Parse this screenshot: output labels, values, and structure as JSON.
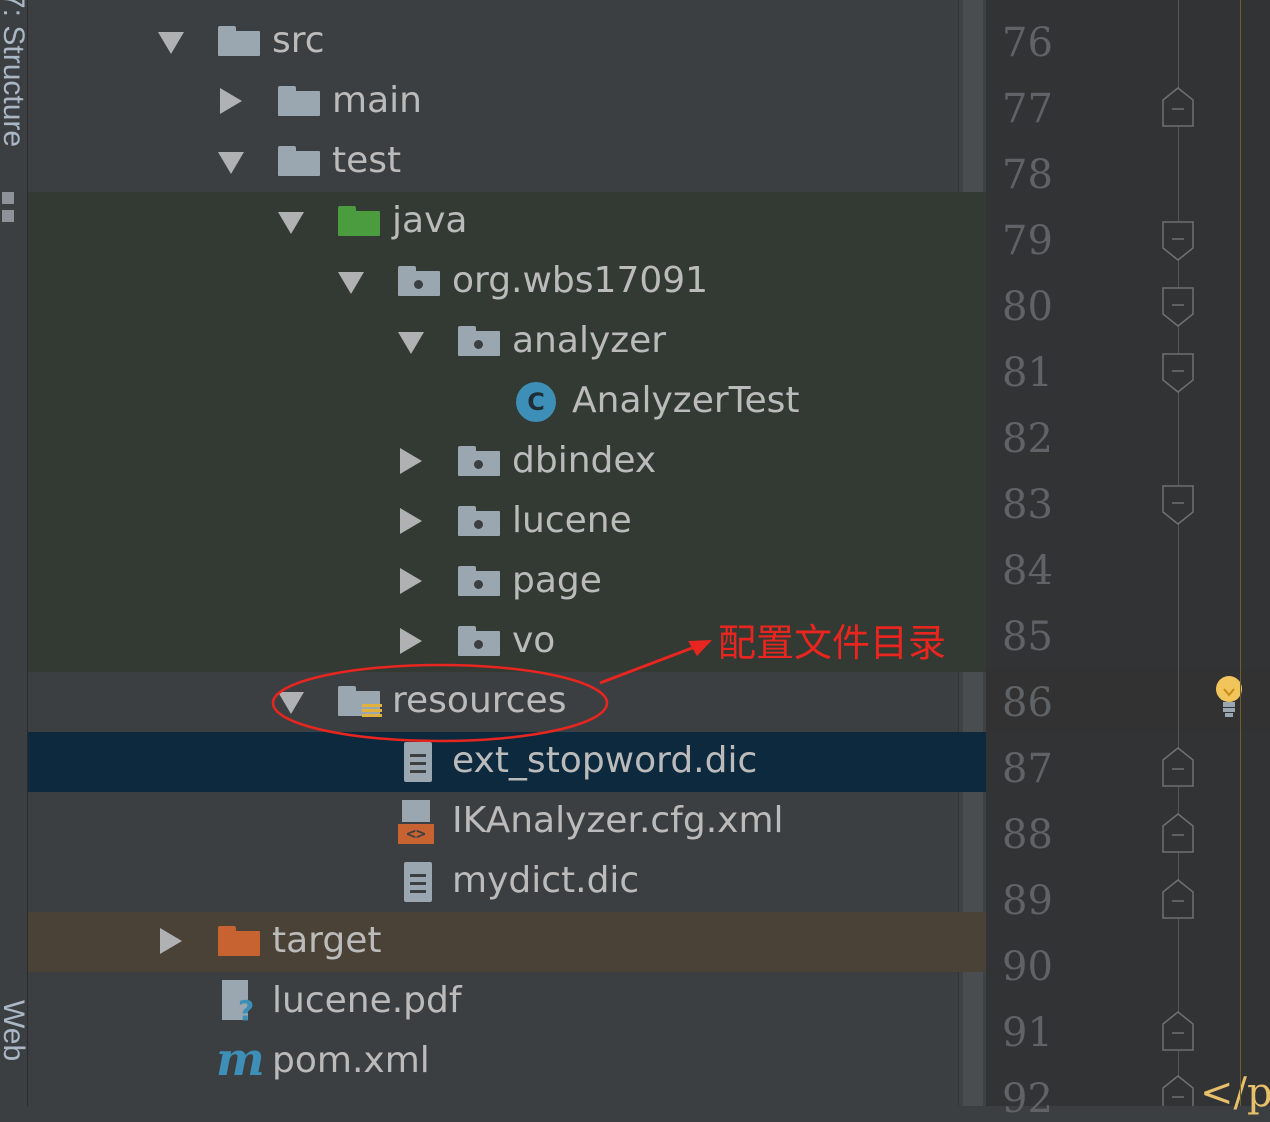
{
  "tool_windows": {
    "structure_label": "7: Structure",
    "web_label": "Web"
  },
  "tree": {
    "src": "src",
    "main": "main",
    "test": "test",
    "java": "java",
    "package": "org.wbs17091",
    "analyzer": "analyzer",
    "analyzer_test": "AnalyzerTest",
    "class_icon_letter": "C",
    "dbindex": "dbindex",
    "lucene": "lucene",
    "page": "page",
    "vo": "vo",
    "resources": "resources",
    "ext_stopword": "ext_stopword.dic",
    "ikanalyzer_cfg": "IKAnalyzer.cfg.xml",
    "mydict": "mydict.dic",
    "target": "target",
    "lucene_pdf": "lucene.pdf",
    "pom": "pom.xml",
    "pom_icon_letter": "m",
    "xml_icon_glyph": "<>",
    "unknown_icon_glyph": "?"
  },
  "gutter": {
    "line_numbers": [
      "76",
      "77",
      "78",
      "79",
      "80",
      "81",
      "82",
      "83",
      "84",
      "85",
      "86",
      "87",
      "88",
      "89",
      "90",
      "91",
      "92"
    ],
    "code_fragment": "</p"
  },
  "annotation": {
    "text": "配置文件目录",
    "color": "#e8261f"
  },
  "colors": {
    "test_source_bg": "#333a33",
    "selected_bg": "#0d293e",
    "excluded_bg": "#4a4237",
    "green_folder": "#4a9c3f",
    "orange_folder": "#c76231"
  }
}
